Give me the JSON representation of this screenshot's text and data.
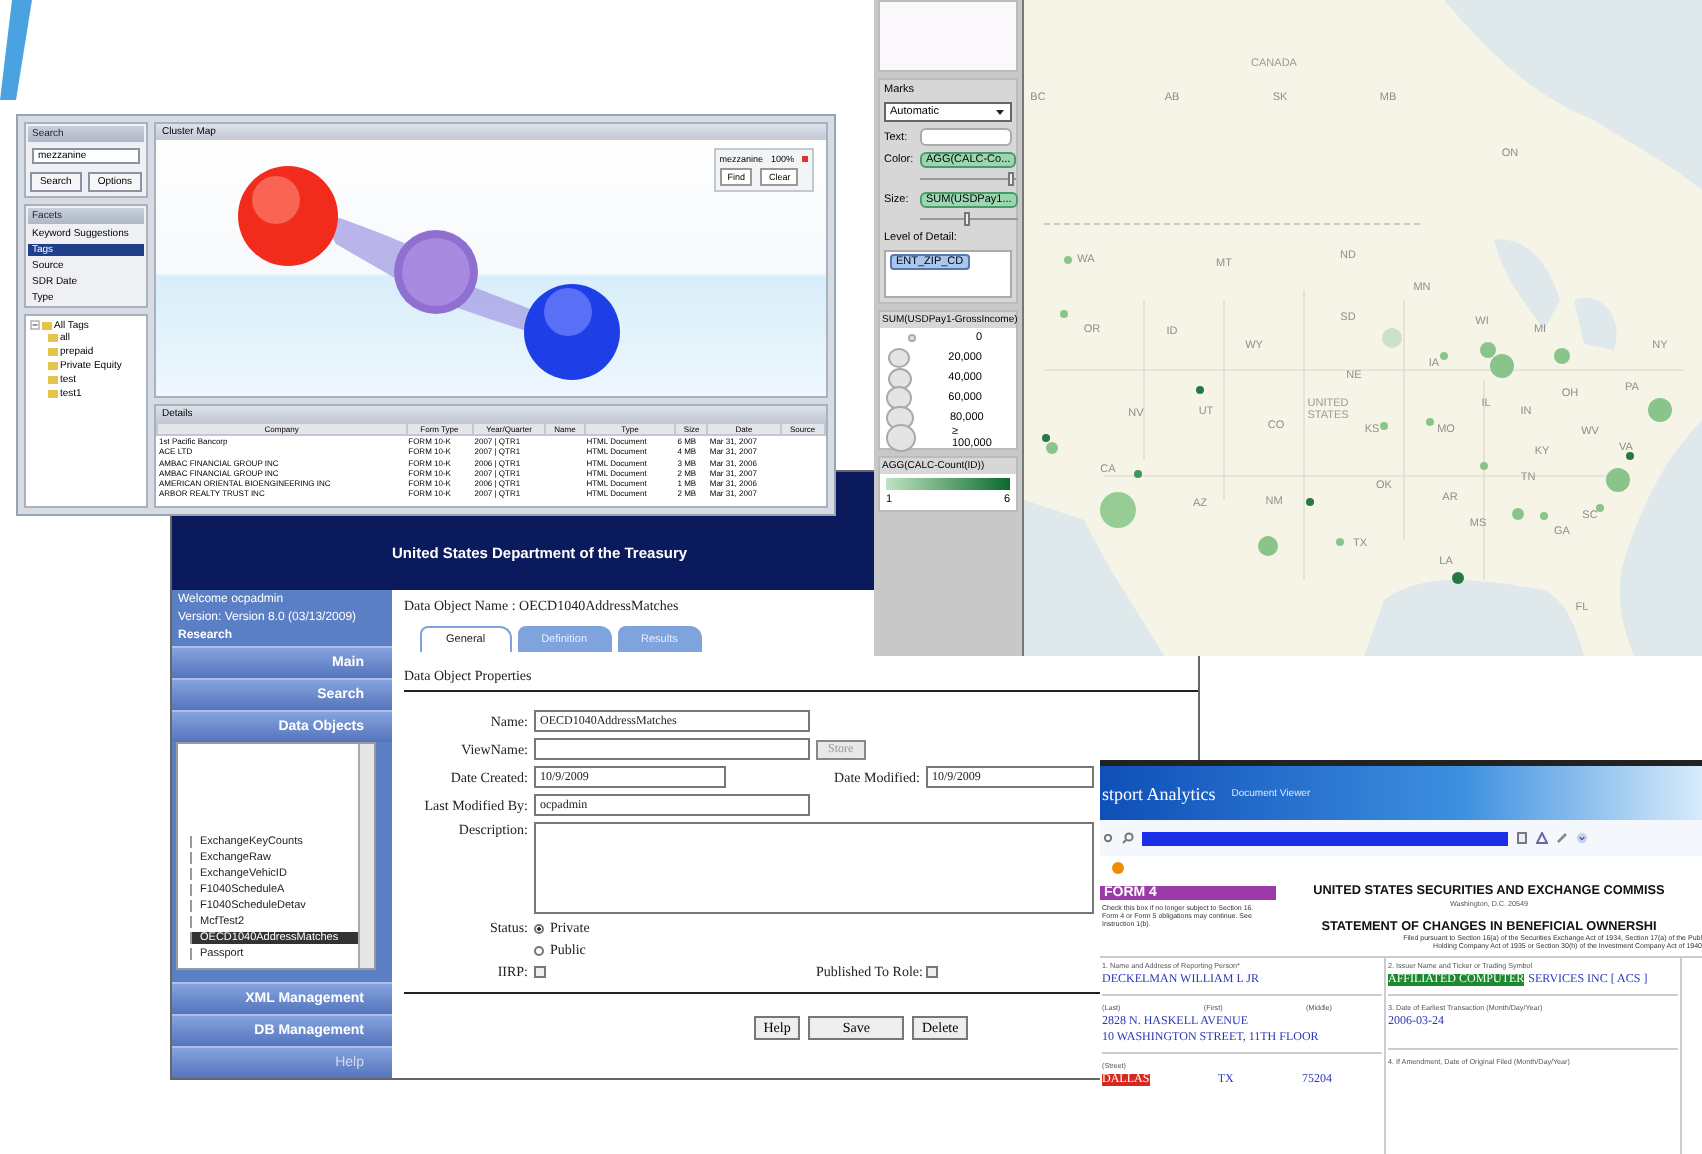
{
  "cluster_app": {
    "search_title": "Search",
    "search_value": "mezzanine",
    "search_button": "Search",
    "options_button": "Options",
    "facets_title": "Facets",
    "facets": [
      {
        "label": "Keyword Suggestions",
        "selected": false
      },
      {
        "label": "Tags",
        "selected": true
      },
      {
        "label": "Source",
        "selected": false
      },
      {
        "label": "SDR Date",
        "selected": false
      },
      {
        "label": "Type",
        "selected": false
      }
    ],
    "tree": {
      "label": "All Tags",
      "expanded": true,
      "children": [
        {
          "label": "all"
        },
        {
          "label": "prepaid"
        },
        {
          "label": "Private Equity"
        },
        {
          "label": "test"
        },
        {
          "label": "test1"
        }
      ]
    },
    "map_title": "Cluster Map",
    "legend": [
      {
        "term": "mezzanine",
        "share": "100%"
      }
    ],
    "legend_buttons": [
      "Find",
      "Clear"
    ],
    "details_title": "Details",
    "table": {
      "columns": [
        "Company",
        "Form Type",
        "Year/Quarter",
        "Name",
        "Type",
        "Size",
        "Date",
        "Source"
      ],
      "rows": [
        {
          "company": "1st Pacific Bancorp",
          "form": "FORM 10-K",
          "year": "2007 | QTR1",
          "type": "HTML Document",
          "size": "6 MB",
          "date": "Mar 31, 2007"
        },
        {
          "company": "ACE LTD",
          "form": "FORM 10-K",
          "year": "2007 | QTR1",
          "type": "HTML Document",
          "size": "4 MB",
          "date": "Mar 31, 2007"
        },
        {
          "company": "AMBAC FINANCIAL GROUP INC",
          "form": "FORM 10-K",
          "year": "2006 | QTR1",
          "type": "HTML Document",
          "size": "3 MB",
          "date": "Mar 31, 2006"
        },
        {
          "company": "AMBAC FINANCIAL GROUP INC",
          "form": "FORM 10-K",
          "year": "2007 | QTR1",
          "type": "HTML Document",
          "size": "2 MB",
          "date": "Mar 31, 2007"
        },
        {
          "company": "AMERICAN ORIENTAL BIOENGINEERING INC",
          "form": "FORM 10-K",
          "year": "2006 | QTR1",
          "type": "HTML Document",
          "size": "1 MB",
          "date": "Mar 31, 2006"
        },
        {
          "company": "ARBOR REALTY TRUST INC",
          "form": "FORM 10-K",
          "year": "2007 | QTR1",
          "type": "HTML Document",
          "size": "2 MB",
          "date": "Mar 31, 2007"
        }
      ]
    }
  },
  "map_app": {
    "marks_title": "Marks",
    "mark_type": "Automatic",
    "shelves": [
      {
        "label": "Text:",
        "kind": "empty"
      },
      {
        "label": "Color:",
        "kind": "pill",
        "value": "AGG(CALC-Co...",
        "level": 0.95
      },
      {
        "label": "Size:",
        "kind": "pill",
        "value": "SUM(USDPay1...",
        "level": 0.5
      }
    ],
    "detail_title": "Level of Detail:",
    "detail_value": "ENT_ZIP_CD",
    "size_legend_title": "SUM(USDPay1-GrossIncome)",
    "size_legend": [
      "0",
      "20,000",
      "40,000",
      "60,000",
      "80,000",
      "≥ 100,000"
    ],
    "color_legend_title": "AGG(CALC-Count(ID))",
    "color_min": "1",
    "color_max": "6",
    "labels": [
      {
        "text": "CANADA",
        "kind": "country"
      },
      {
        "text": "BC",
        "kind": "region"
      },
      {
        "text": "AB",
        "kind": "region"
      },
      {
        "text": "SK",
        "kind": "region"
      },
      {
        "text": "MB",
        "kind": "region"
      },
      {
        "text": "ON",
        "kind": "region"
      },
      {
        "text": "WA",
        "kind": "region"
      },
      {
        "text": "MT",
        "kind": "region"
      },
      {
        "text": "ND",
        "kind": "region"
      },
      {
        "text": "MN",
        "kind": "region"
      },
      {
        "text": "OR",
        "kind": "region"
      },
      {
        "text": "ID",
        "kind": "region"
      },
      {
        "text": "SD",
        "kind": "region"
      },
      {
        "text": "WI",
        "kind": "region"
      },
      {
        "text": "MI",
        "kind": "region"
      },
      {
        "text": "WY",
        "kind": "region"
      },
      {
        "text": "NY",
        "kind": "region"
      },
      {
        "text": "NE",
        "kind": "region"
      },
      {
        "text": "IA",
        "kind": "region"
      },
      {
        "text": "PA",
        "kind": "region"
      },
      {
        "text": "NV",
        "kind": "region"
      },
      {
        "text": "UT",
        "kind": "region"
      },
      {
        "text": "CO",
        "kind": "region"
      },
      {
        "text": "UNITED STATES",
        "kind": "country"
      },
      {
        "text": "KS",
        "kind": "region"
      },
      {
        "text": "MO",
        "kind": "region"
      },
      {
        "text": "IL",
        "kind": "region"
      },
      {
        "text": "IN",
        "kind": "region"
      },
      {
        "text": "OH",
        "kind": "region"
      },
      {
        "text": "WV",
        "kind": "region"
      },
      {
        "text": "VA",
        "kind": "region"
      },
      {
        "text": "KY",
        "kind": "region"
      },
      {
        "text": "CA",
        "kind": "region"
      },
      {
        "text": "AZ",
        "kind": "region"
      },
      {
        "text": "NM",
        "kind": "region"
      },
      {
        "text": "OK",
        "kind": "region"
      },
      {
        "text": "AR",
        "kind": "region"
      },
      {
        "text": "TN",
        "kind": "region"
      },
      {
        "text": "SC",
        "kind": "region"
      },
      {
        "text": "MS",
        "kind": "region"
      },
      {
        "text": "GA",
        "kind": "region"
      },
      {
        "text": "TX",
        "kind": "region"
      },
      {
        "text": "LA",
        "kind": "region"
      },
      {
        "text": "FL",
        "kind": "region"
      }
    ]
  },
  "treasury_app": {
    "subtitle": "United States Department of the Treasury",
    "welcome": "Welcome ocpadmin",
    "version": "Version: Version 8.0 (03/13/2009)",
    "role": "Research",
    "menu_top": [
      {
        "label": "Main",
        "disabled": false
      },
      {
        "label": "Search",
        "disabled": false
      },
      {
        "label": "Data Objects",
        "disabled": false
      }
    ],
    "objects": [
      {
        "label": "ExchangeKeyCounts",
        "selected": false
      },
      {
        "label": "ExchangeRaw",
        "selected": false
      },
      {
        "label": "ExchangeVehicID",
        "selected": false
      },
      {
        "label": "F1040ScheduleA",
        "selected": false
      },
      {
        "label": "F1040ScheduleDetav",
        "selected": false
      },
      {
        "label": "McfTest2",
        "selected": false
      },
      {
        "label": "OECD1040AddressMatches",
        "selected": true
      },
      {
        "label": "Passport",
        "selected": false
      }
    ],
    "menu_bottom": [
      {
        "label": "XML Management",
        "disabled": false
      },
      {
        "label": "DB Management",
        "disabled": false
      },
      {
        "label": "Help",
        "disabled": true
      }
    ],
    "object_name": "Data Object Name : OECD1040AddressMatches",
    "tabs": [
      {
        "label": "General",
        "selected": true
      },
      {
        "label": "Definition",
        "selected": false
      },
      {
        "label": "Results",
        "selected": false
      }
    ],
    "section": "Data Object Properties",
    "name_label": "Name:",
    "name_value": "OECD1040AddressMatches",
    "view_label": "ViewName:",
    "store_button": "Store",
    "created_label": "Date Created:",
    "created_value": "10/9/2009",
    "modified_label": "Date Modified:",
    "modified_value": "10/9/2009",
    "by_label": "Last Modified By:",
    "by_value": "ocpadmin",
    "description_label": "Description:",
    "status_label": "Status:",
    "status_options": [
      {
        "label": "Private",
        "selected": true
      },
      {
        "label": "Public",
        "selected": false
      }
    ],
    "iirp_label": "IIRP:",
    "iirp_checked": false,
    "published_label": "Published To Role:",
    "published_checked": false,
    "buttons": [
      "Help",
      "Save",
      "Delete"
    ]
  },
  "viewer_app": {
    "title": "stport Analytics",
    "subtitle": "Document Viewer",
    "form_label": "FORM 4",
    "heading": "UNITED STATES SECURITIES AND EXCHANGE COMMISS",
    "city_line": "Washington, D.C. 20549",
    "statement": "STATEMENT OF CHANGES IN BENEFICIAL OWNERSHI",
    "checkbox_note": "Check this box if no longer subject to Section 16. Form 4 or Form 5 obligations may continue. See Instruction 1(b).",
    "filed_line_1": "Filed pursuant to Section 16(a) of the Securities Exchange Act of 1934, Section 17(a) of the Publ",
    "filed_line_2": "Holding Company Act of 1935 or Section 30(h) of the Investment Company Act of 1940",
    "person_label": "1. Name and Address of Reporting Person*",
    "person": "DECKELMAN WILLIAM L JR",
    "name_parts": [
      "(Last)",
      "(First)",
      "(Middle)"
    ],
    "address_1": "2828 N. HASKELL AVENUE",
    "address_2": "10 WASHINGTON STREET, 11TH FLOOR",
    "street_label": "(Street)",
    "city": "DALLAS",
    "state": "TX",
    "zip": "75204",
    "issuer_label": "2. Issuer Name and Ticker or Trading Symbol",
    "issuer_hit": "AFFILIATED COMPUTER",
    "issuer_rest": "SERVICES INC [ ACS ]",
    "date_label": "3. Date of Earliest Transaction (Month/Day/Year)",
    "date": "2006-03-24",
    "amend_label": "4. If Amendment, Date of Original Filed (Month/Day/Year)"
  }
}
